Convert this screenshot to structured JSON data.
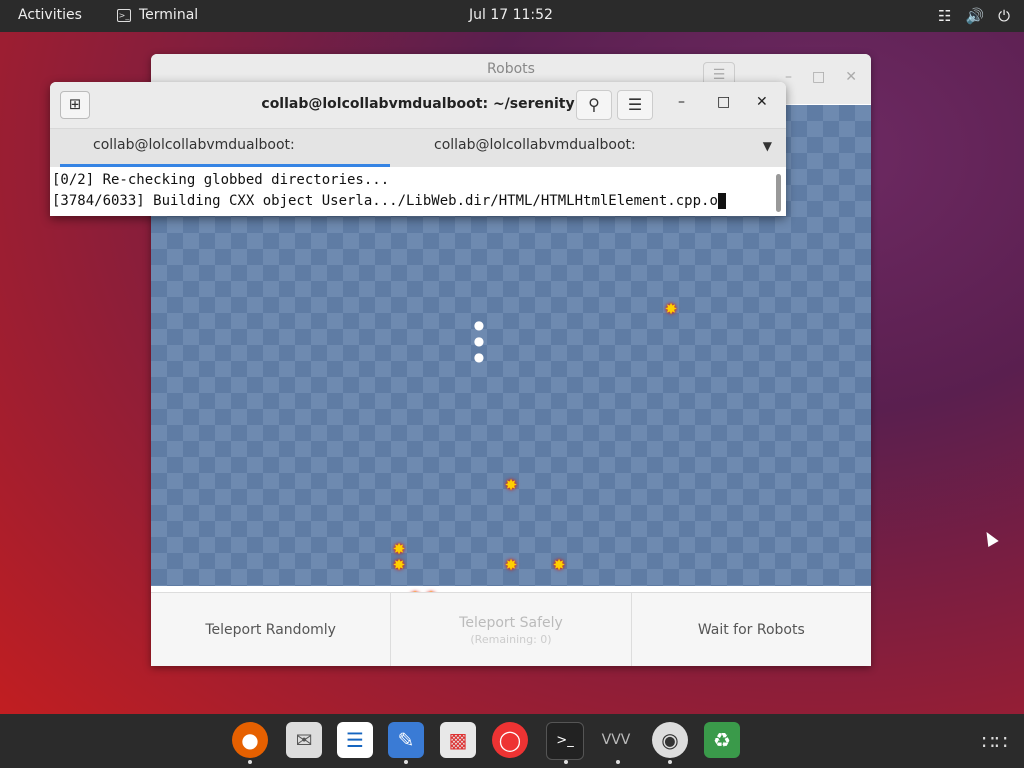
{
  "topbar": {
    "activities": "Activities",
    "app_name": "Terminal",
    "clock": "Jul 17  11:52",
    "tray_icons": [
      "network-icon",
      "volume-icon",
      "power-icon"
    ]
  },
  "robots_window": {
    "title": "Robots",
    "controls": {
      "teleport_randomly": "Teleport Randomly",
      "teleport_safely": "Teleport Safely",
      "teleport_safely_sub": "(Remaining: 0)",
      "wait": "Wait for Robots"
    }
  },
  "terminal_window": {
    "title": "collab@lolcollabvmdualboot: ~/serenity",
    "tabs": [
      {
        "label": "collab@lolcollabvmdualboot: ~/serenity",
        "active": true
      },
      {
        "label": "collab@lolcollabvmdualboot: ~/serenity",
        "active": false
      }
    ],
    "lines": [
      "[0/2] Re-checking globbed directories...",
      "[3784/6033] Building CXX object Userla.../LibWeb.dir/HTML/HTMLHtmlElement.cpp.o"
    ]
  },
  "dock": {
    "apps": [
      "firefox-icon",
      "evolution-icon",
      "writer-icon",
      "text-editor-icon",
      "software-icon",
      "help-icon",
      "terminal-icon",
      "vm-icon",
      "robots-icon",
      "trash-icon"
    ]
  },
  "colors": {
    "accent": "#3584e4",
    "topbar": "#2b2b2b",
    "board_light": "#6e8ab0",
    "board_dark": "#5f7ca4"
  }
}
